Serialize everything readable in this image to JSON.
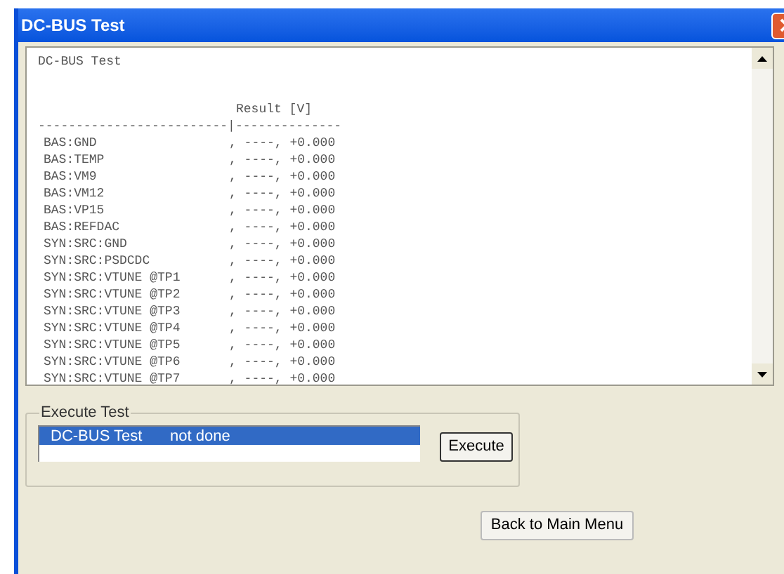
{
  "window": {
    "title": "DC-BUS Test"
  },
  "report": {
    "title": "DC-BUS Test",
    "header": "Result [V]",
    "separator_left": "-------------------------|",
    "separator_right": "--------------",
    "rows": [
      {
        "label": "BAS:GND",
        "value": ", ----, +0.000"
      },
      {
        "label": "BAS:TEMP",
        "value": ", ----, +0.000"
      },
      {
        "label": "BAS:VM9",
        "value": ", ----, +0.000"
      },
      {
        "label": "BAS:VM12",
        "value": ", ----, +0.000"
      },
      {
        "label": "BAS:VP15",
        "value": ", ----, +0.000"
      },
      {
        "label": "BAS:REFDAC",
        "value": ", ----, +0.000"
      },
      {
        "label": "SYN:SRC:GND",
        "value": ", ----, +0.000"
      },
      {
        "label": "SYN:SRC:PSDCDC",
        "value": ", ----, +0.000"
      },
      {
        "label": "SYN:SRC:VTUNE @TP1",
        "value": ", ----, +0.000"
      },
      {
        "label": "SYN:SRC:VTUNE @TP2",
        "value": ", ----, +0.000"
      },
      {
        "label": "SYN:SRC:VTUNE @TP3",
        "value": ", ----, +0.000"
      },
      {
        "label": "SYN:SRC:VTUNE @TP4",
        "value": ", ----, +0.000"
      },
      {
        "label": "SYN:SRC:VTUNE @TP5",
        "value": ", ----, +0.000"
      },
      {
        "label": "SYN:SRC:VTUNE @TP6",
        "value": ", ----, +0.000"
      },
      {
        "label": "SYN:SRC:VTUNE @TP7",
        "value": ", ----, +0.000"
      }
    ]
  },
  "execute_group": {
    "title": "Execute Test",
    "tests": [
      {
        "name": "DC-BUS Test",
        "status": "not done",
        "selected": true
      }
    ],
    "execute_button": "Execute"
  },
  "back_button": "Back to Main Menu"
}
